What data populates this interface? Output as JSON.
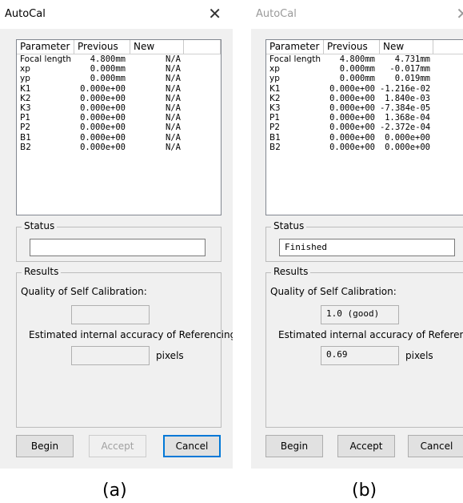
{
  "dialogs": [
    {
      "title": "AutoCal",
      "close": "✕",
      "columns": [
        "Parameter",
        "Previous",
        "New",
        ""
      ],
      "rows": [
        [
          "Focal length",
          "4.800mm",
          "N/A"
        ],
        [
          "xp",
          "0.000mm",
          "N/A"
        ],
        [
          "yp",
          "0.000mm",
          "N/A"
        ],
        [
          "K1",
          "0.000e+00",
          "N/A"
        ],
        [
          "K2",
          "0.000e+00",
          "N/A"
        ],
        [
          "K3",
          "0.000e+00",
          "N/A"
        ],
        [
          "P1",
          "0.000e+00",
          "N/A"
        ],
        [
          "P2",
          "0.000e+00",
          "N/A"
        ],
        [
          "B1",
          "0.000e+00",
          "N/A"
        ],
        [
          "B2",
          "0.000e+00",
          "N/A"
        ]
      ],
      "status_label": "Status",
      "status_value": "",
      "results_label": "Results",
      "quality_label": "Quality of Self Calibration:",
      "quality_value": "",
      "accuracy_label": "Estimated internal accuracy of Referencing:",
      "accuracy_value": "",
      "units": "pixels",
      "buttons": {
        "begin": "Begin",
        "accept": "Accept",
        "cancel": "Cancel"
      },
      "caption": "(a)"
    },
    {
      "title": "AutoCal",
      "close": "✕",
      "columns": [
        "Parameter",
        "Previous",
        "New",
        ""
      ],
      "rows": [
        [
          "Focal length",
          "4.800mm",
          "4.731mm"
        ],
        [
          "xp",
          "0.000mm",
          "-0.017mm"
        ],
        [
          "yp",
          "0.000mm",
          "0.019mm"
        ],
        [
          "K1",
          "0.000e+00",
          "-1.216e-02"
        ],
        [
          "K2",
          "0.000e+00",
          "1.840e-03"
        ],
        [
          "K3",
          "0.000e+00",
          "-7.384e-05"
        ],
        [
          "P1",
          "0.000e+00",
          "1.368e-04"
        ],
        [
          "P2",
          "0.000e+00",
          "-2.372e-04"
        ],
        [
          "B1",
          "0.000e+00",
          "0.000e+00"
        ],
        [
          "B2",
          "0.000e+00",
          "0.000e+00"
        ]
      ],
      "status_label": "Status",
      "status_value": "Finished",
      "results_label": "Results",
      "quality_label": "Quality of Self Calibration:",
      "quality_value": "1.0 (good)",
      "accuracy_label": "Estimated internal accuracy of Referencing:",
      "accuracy_value": "0.69",
      "units": "pixels",
      "buttons": {
        "begin": "Begin",
        "accept": "Accept",
        "cancel": "Cancel"
      },
      "caption": "(b)"
    }
  ]
}
